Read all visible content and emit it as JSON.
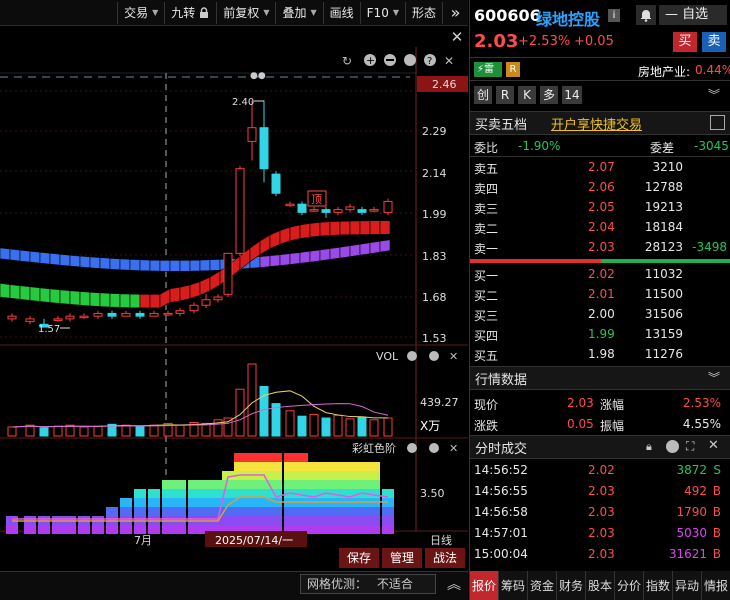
{
  "toolbar": {
    "items": [
      {
        "label": "交易",
        "has_dropdown": true
      },
      {
        "label": "九转",
        "icon": "lock-icon"
      },
      {
        "label": "前复权",
        "has_dropdown": true
      },
      {
        "label": "叠加",
        "has_dropdown": true
      },
      {
        "label": "画线"
      },
      {
        "label": "F10",
        "has_dropdown": true
      },
      {
        "label": "形态"
      }
    ],
    "expand_symbol": "»"
  },
  "chart": {
    "price_label": "2.46",
    "price_axis": [
      "2.29",
      "2.14",
      "1.99",
      "1.83",
      "1.68",
      "1.53"
    ],
    "high_label": "2.40",
    "low_label": "1.57",
    "ding_label": "顶",
    "vol_title": "VOL",
    "vol_axis": "439.27",
    "vol_unit": "X万",
    "rainbow_title": "彩虹色阶",
    "rainbow_axis": "3.50",
    "x_month": "7月",
    "x_date": "2025/07/14/一",
    "x_period": "日线",
    "buttons": {
      "save": "保存",
      "manage": "管理",
      "battle": "战法"
    },
    "bottom_label": "网格优测：",
    "bottom_value": "不适合"
  },
  "stock": {
    "code": "600606",
    "name": "绿地控股",
    "price": "2.03",
    "change_pct": "+2.53%",
    "change_val": "+0.05",
    "watch_btn": "自选",
    "buy_btn": "买",
    "sell_btn": "卖",
    "badge_lei": "雷",
    "badge_r": "R",
    "industry": "房地产业:",
    "industry_pct": "0.44%",
    "tags": [
      "创",
      "R",
      "K",
      "多",
      "14"
    ]
  },
  "orderbook": {
    "title": "买卖五档",
    "link": "开户享快捷交易",
    "weibi_label": "委比",
    "weibi_value": "-1.90%",
    "weicha_label": "委差",
    "weicha_value": "-3045",
    "asks": [
      {
        "label": "卖五",
        "price": "2.07",
        "vol": "3210",
        "extra": ""
      },
      {
        "label": "卖四",
        "price": "2.06",
        "vol": "12788",
        "extra": ""
      },
      {
        "label": "卖三",
        "price": "2.05",
        "vol": "19213",
        "extra": ""
      },
      {
        "label": "卖二",
        "price": "2.04",
        "vol": "18184",
        "extra": ""
      },
      {
        "label": "卖一",
        "price": "2.03",
        "vol": "28123",
        "extra": "-3498"
      }
    ],
    "bids": [
      {
        "label": "买一",
        "price": "2.02",
        "vol": "11032"
      },
      {
        "label": "买二",
        "price": "2.01",
        "vol": "11500"
      },
      {
        "label": "买三",
        "price": "2.00",
        "vol": "31506"
      },
      {
        "label": "买四",
        "price": "1.99",
        "vol": "13159"
      },
      {
        "label": "买五",
        "price": "1.98",
        "vol": "11276"
      }
    ]
  },
  "market": {
    "title": "行情数据",
    "rows": [
      {
        "l1": "现价",
        "v1": "2.03",
        "l2": "涨幅",
        "v2": "2.53%"
      },
      {
        "l1": "涨跌",
        "v1": "0.05",
        "l2": "振幅",
        "v2": "4.55%"
      }
    ]
  },
  "ticks": {
    "title": "分时成交",
    "rows": [
      {
        "time": "14:56:52",
        "price": "2.02",
        "vol": "3872",
        "side": "S"
      },
      {
        "time": "14:56:55",
        "price": "2.03",
        "vol": "492",
        "side": "B"
      },
      {
        "time": "14:56:58",
        "price": "2.03",
        "vol": "1790",
        "side": "B"
      },
      {
        "time": "14:57:01",
        "price": "2.03",
        "vol": "5030",
        "side": "B"
      },
      {
        "time": "15:00:04",
        "price": "2.03",
        "vol": "31621",
        "side": "B"
      }
    ]
  },
  "tabs": [
    "报价",
    "筹码",
    "资金",
    "财务",
    "股本",
    "分价",
    "指数",
    "异动",
    "情报"
  ]
}
